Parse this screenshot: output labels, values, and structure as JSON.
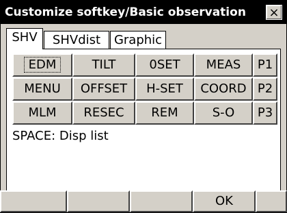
{
  "window": {
    "title": "Customize softkey/Basic observation",
    "close_glyph": "×"
  },
  "tabs": [
    {
      "label": "SHV",
      "active": true
    },
    {
      "label": "SHVdist",
      "active": false
    },
    {
      "label": "Graphic",
      "active": false
    }
  ],
  "keys": {
    "row1": [
      "EDM",
      "TILT",
      "0SET",
      "MEAS",
      "P1"
    ],
    "row2": [
      "MENU",
      "OFFSET",
      "H-SET",
      "COORD",
      "P2"
    ],
    "row3": [
      "MLM",
      "RESEC",
      "REM",
      "S-O",
      "P3"
    ]
  },
  "info_text": "SPACE: Disp list",
  "softkeys": [
    "",
    "",
    "",
    "OK",
    ""
  ]
}
